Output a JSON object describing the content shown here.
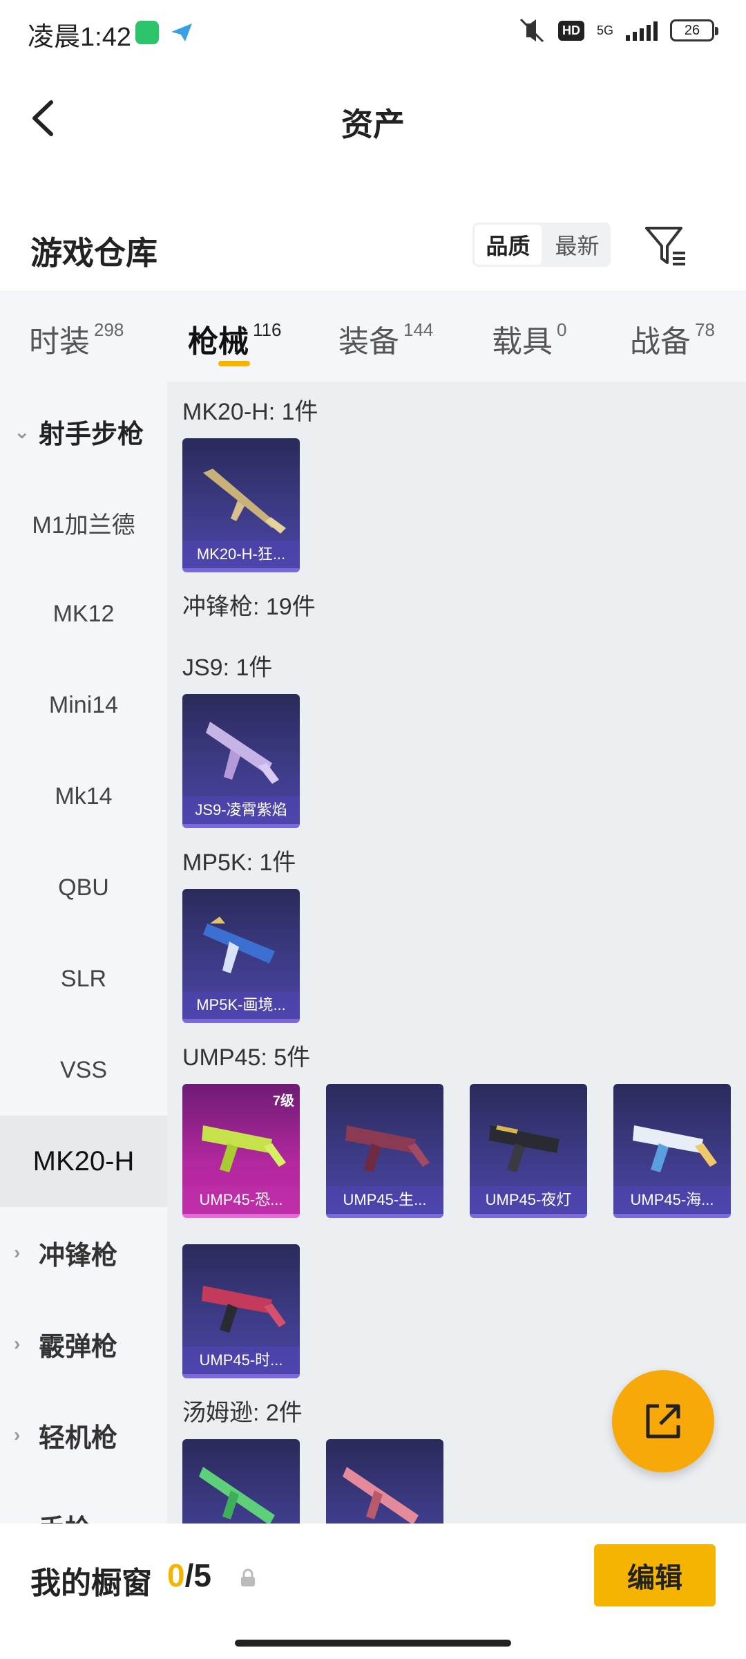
{
  "status": {
    "time": "凌晨1:42",
    "hd": "HD",
    "network": "5G",
    "battery": "26"
  },
  "nav": {
    "title": "资产"
  },
  "warehouse": {
    "title": "游戏仓库",
    "sort_options": [
      "品质",
      "最新"
    ]
  },
  "tabs": [
    {
      "label": "时装",
      "count": "298"
    },
    {
      "label": "枪械",
      "count": "116"
    },
    {
      "label": "装备",
      "count": "144"
    },
    {
      "label": "载具",
      "count": "0"
    },
    {
      "label": "战备",
      "count": "78"
    }
  ],
  "sidebar": {
    "group_open": "射手步枪",
    "items": [
      "M1加兰德",
      "MK12",
      "Mini14",
      "Mk14",
      "QBU",
      "SLR",
      "VSS",
      "MK20-H"
    ],
    "groups_closed": [
      "冲锋枪",
      "霰弹枪",
      "轻机枪",
      "手枪"
    ]
  },
  "sections": {
    "mk20h": "MK20-H: 1件",
    "smg": "冲锋枪: 19件",
    "js9": "JS9: 1件",
    "mp5k": "MP5K: 1件",
    "ump45": "UMP45: 5件",
    "tommy": "汤姆逊: 2件"
  },
  "cards": {
    "mk20h": "MK20-H-狂...",
    "js9": "JS9-凌霄紫焰",
    "mp5k": "MP5K-画境...",
    "ump1": "UMP45-恐...",
    "ump1_level": "7级",
    "ump2": "UMP45-生...",
    "ump3": "UMP45-夜灯",
    "ump4": "UMP45-海...",
    "ump5": "UMP45-时..."
  },
  "showcase": {
    "label": "我的橱窗",
    "current": "0",
    "total": "/5",
    "edit": "编辑"
  },
  "colors": {
    "accent": "#f5b400",
    "fab": "#f7a90a",
    "card_purple": "#3d3b86",
    "card_pink": "#b2289e"
  }
}
